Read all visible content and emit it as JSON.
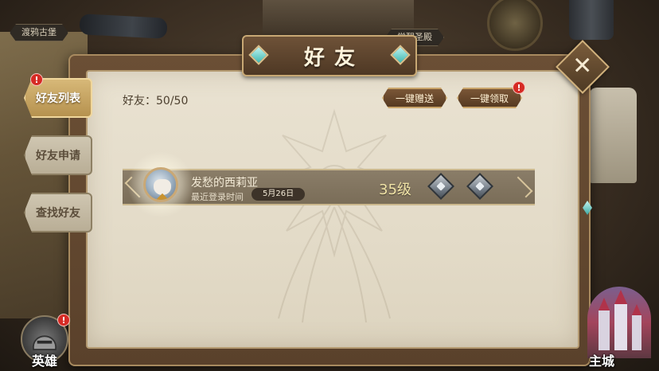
{
  "background": {
    "location_left": "渡鸦古堡",
    "location_right": "觉醒圣殿"
  },
  "window": {
    "title": "好友",
    "close_icon": "close-icon"
  },
  "tabs": [
    {
      "label": "好友列表",
      "active": true,
      "badge": "!"
    },
    {
      "label": "好友申请",
      "active": false
    },
    {
      "label": "查找好友",
      "active": false
    }
  ],
  "header": {
    "friend_count": "好友：50/50",
    "gift_all_label": "一键赠送",
    "claim_all_label": "一键领取",
    "claim_badge": "!"
  },
  "friends": [
    {
      "name": "发愁的西莉亚",
      "last_login_label": "最近登录时间",
      "last_login_date": "5月26日",
      "level": "35级"
    }
  ],
  "bottom_nav": {
    "hero_label": "英雄",
    "hero_badge": "!",
    "castle_label": "主城"
  },
  "colors": {
    "accent_gold": "#c9a46a",
    "panel_bg": "#e9e2d1",
    "badge_red": "#d62b25",
    "level_text": "#f0e3a6"
  }
}
